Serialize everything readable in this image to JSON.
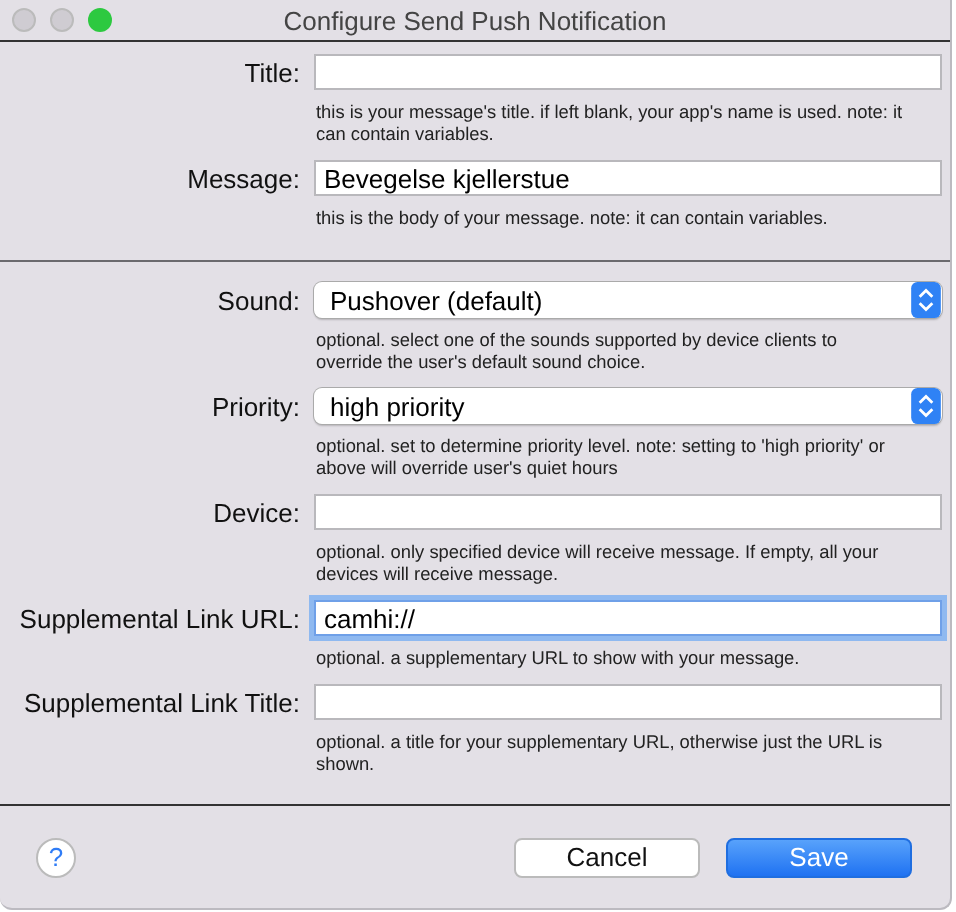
{
  "window": {
    "title": "Configure Send Push Notification"
  },
  "sections": [
    {
      "fields": [
        {
          "kind": "text",
          "label": "Title:",
          "focused": false,
          "hint": "this is your message's title. if left blank, your app's name is used. note: it can contain variables."
        },
        {
          "kind": "text",
          "label": "Message:",
          "value": "Bevegelse kjellerstue",
          "focused": false,
          "hint": "this is the body of your message. note: it can contain variables."
        }
      ]
    },
    {
      "fields": [
        {
          "kind": "popup",
          "label": "Sound:",
          "value": "Pushover (default)",
          "focused": false,
          "hint": "optional. select one of the sounds supported by device clients to override the user's default sound choice."
        },
        {
          "kind": "popup",
          "label": "Priority:",
          "value": "high priority",
          "focused": false,
          "hint": "optional. set to determine priority level. note: setting to 'high priority' or above will override user's quiet hours"
        },
        {
          "kind": "text",
          "label": "Device:",
          "focused": false,
          "hint": "optional. only specified device will receive message. If empty, all your devices will receive message."
        },
        {
          "kind": "text",
          "label": "Supplemental Link URL:",
          "value": "camhi://",
          "focused": true,
          "hint": "optional. a supplementary URL to show with your message."
        },
        {
          "kind": "text",
          "label": "Supplemental Link Title:",
          "focused": false,
          "hint": "optional. a title for your supplementary URL, otherwise just the URL is shown."
        }
      ]
    }
  ],
  "help": "?",
  "buttons": [
    {
      "label": "Cancel",
      "kind": "normal"
    },
    {
      "label": "Save",
      "kind": "default"
    }
  ]
}
